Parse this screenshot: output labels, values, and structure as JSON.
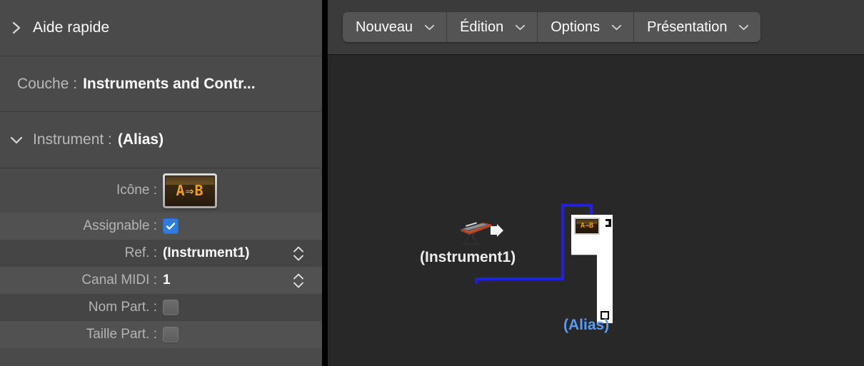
{
  "inspector": {
    "quick_help": {
      "label": "Aide rapide",
      "disclosure": "collapsed"
    },
    "layer": {
      "label": "Couche :",
      "value": "Instruments and Contr..."
    },
    "instrument": {
      "label": "Instrument :",
      "value": "(Alias)",
      "disclosure": "expanded"
    },
    "fields": [
      {
        "name": "icon",
        "label": "Icône :",
        "control": "icon-well",
        "value": "A⇒B"
      },
      {
        "name": "assignable",
        "label": "Assignable :",
        "control": "checkbox",
        "checked": true
      },
      {
        "name": "ref",
        "label": "Ref. :",
        "control": "stepper-text",
        "value": "(Instrument1)"
      },
      {
        "name": "midi_channel",
        "label": "Canal MIDI :",
        "control": "stepper-text",
        "value": "1"
      },
      {
        "name": "part_name",
        "label": "Nom Part. :",
        "control": "checkbox",
        "checked": false
      },
      {
        "name": "part_size",
        "label": "Taille Part. :",
        "control": "checkbox",
        "checked": false
      }
    ]
  },
  "menubar": {
    "items": [
      {
        "label": "Nouveau",
        "icon": "chevron-down-icon"
      },
      {
        "label": "Édition",
        "icon": "chevron-down-icon"
      },
      {
        "label": "Options",
        "icon": "chevron-down-icon"
      },
      {
        "label": "Présentation",
        "icon": "chevron-down-icon"
      }
    ]
  },
  "canvas": {
    "source_object": {
      "label": "(Instrument1)",
      "icon": "keyboard-synth-icon",
      "port_icon": "output-arrow-icon"
    },
    "alias_object": {
      "label": "(Alias)",
      "icon": "alias-ab-icon",
      "selected": true
    },
    "cable": {
      "color": "#2020e0",
      "from": "(Instrument1)",
      "to": "(Alias)"
    }
  },
  "colors": {
    "accent_checkbox": "#2f7ce0",
    "alias_label": "#5a9cf5",
    "cable": "#2020e0",
    "icon_amber": "#f0a01e",
    "sidebar_bg": "#4a4a4a",
    "menubar_bg": "#3b3b3b",
    "canvas_bg": "#282828"
  }
}
